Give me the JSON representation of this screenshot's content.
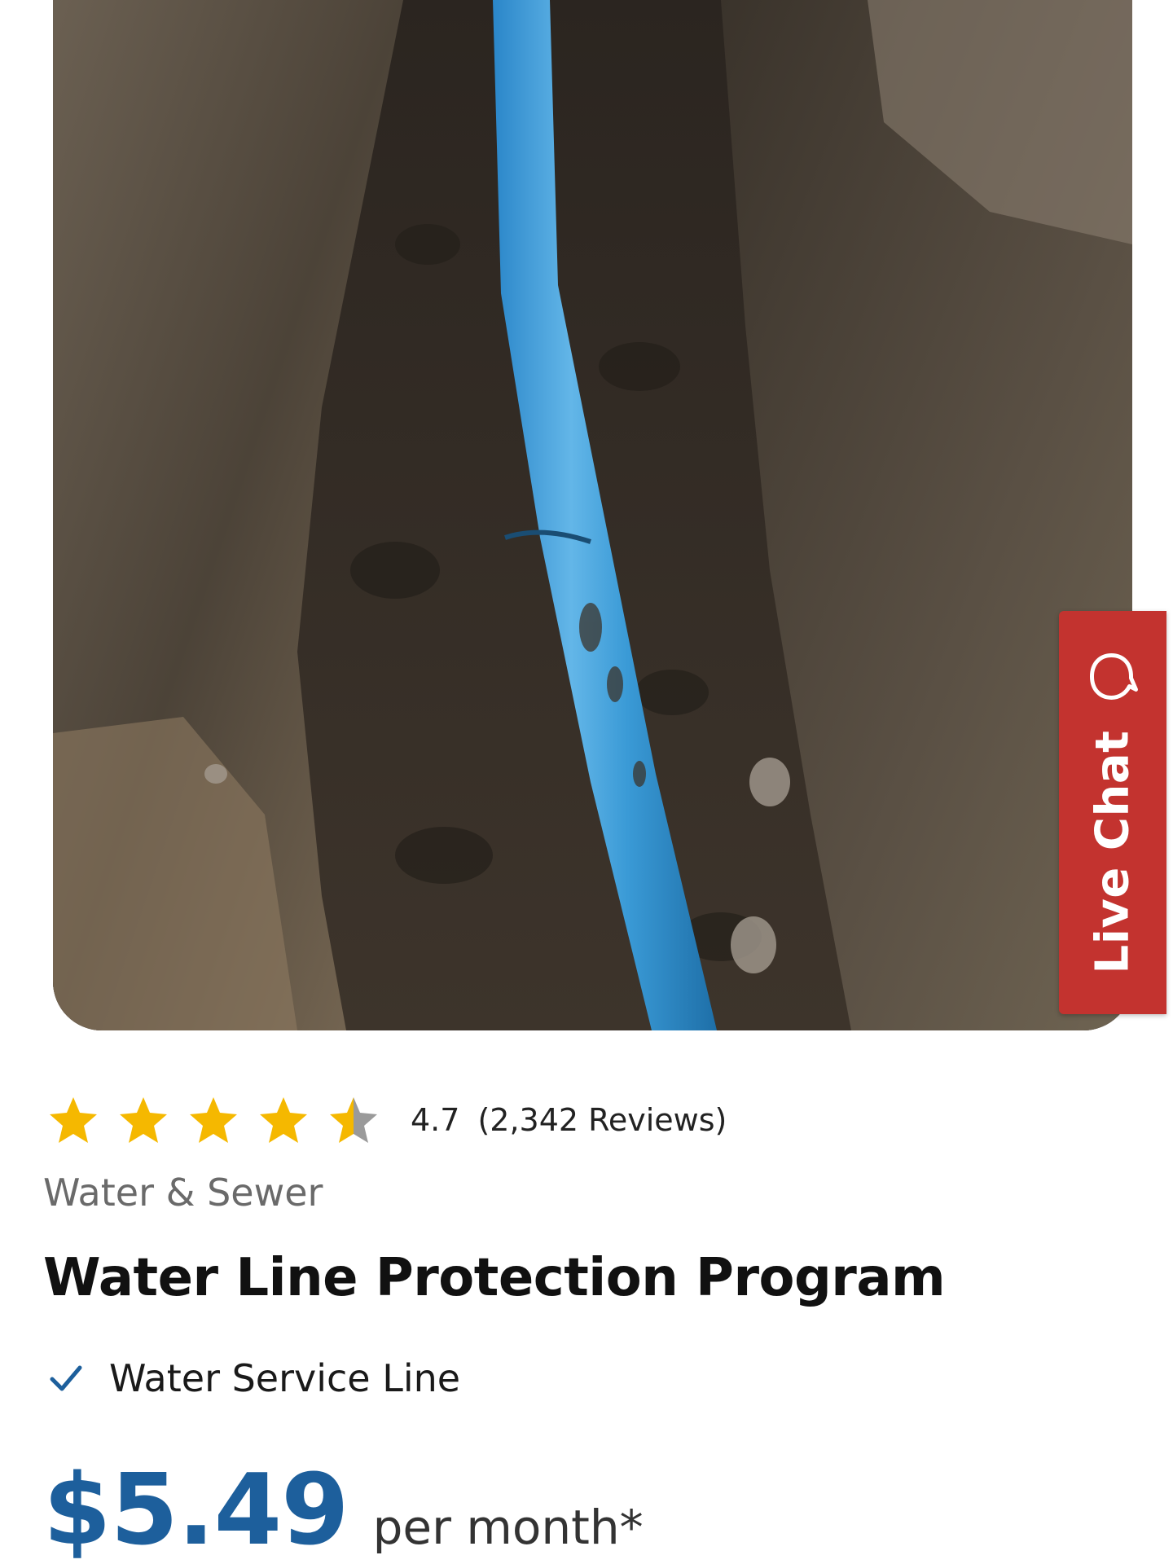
{
  "product": {
    "image_alt": "Blue water pipe in a dirt trench",
    "rating": {
      "value": "4.7",
      "count_text": "(2,342 Reviews)",
      "stars_filled": 4.5,
      "stars_total": 5,
      "star_color": "#f5b800",
      "star_empty_color": "#9a9a9a"
    },
    "category": "Water & Sewer",
    "title": "Water Line Protection Program",
    "features": [
      {
        "label": "Water Service Line",
        "icon": "check-icon"
      }
    ],
    "price": "$5.49",
    "price_suffix": "per month*"
  },
  "live_chat": {
    "label": "Live Chat",
    "icon": "chat-bubble-icon",
    "color": "#c3332f"
  },
  "colors": {
    "accent_blue": "#1d5f9c"
  }
}
